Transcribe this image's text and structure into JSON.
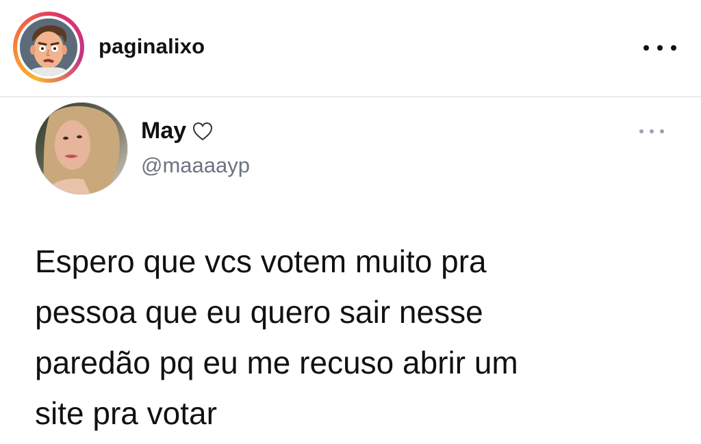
{
  "post_header": {
    "username": "paginalixo",
    "avatar_icon": "cartoon-face-avatar",
    "more_icon": "more-horizontal-icon",
    "ring_colors": [
      "#f9b233",
      "#f77737",
      "#e1306c",
      "#c13584"
    ]
  },
  "tweet": {
    "display_name": "May",
    "name_emoji_icon": "white-heart-icon",
    "handle": "@maaaayp",
    "more_icon": "more-horizontal-icon",
    "text_lines": [
      "Espero que vcs votem muito pra",
      "pessoa que eu quero sair nesse",
      "paredão pq eu me recuso abrir um",
      "site pra votar"
    ]
  }
}
